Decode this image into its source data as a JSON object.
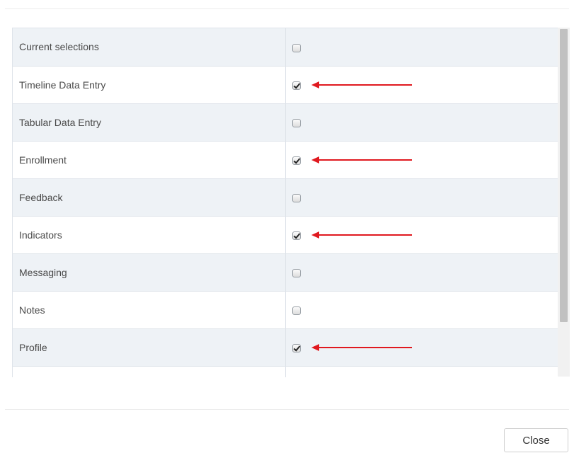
{
  "rows": [
    {
      "label": "Current selections",
      "checked": false,
      "arrow": false
    },
    {
      "label": "Timeline Data Entry",
      "checked": true,
      "arrow": true
    },
    {
      "label": "Tabular Data Entry",
      "checked": false,
      "arrow": false
    },
    {
      "label": "Enrollment",
      "checked": true,
      "arrow": true
    },
    {
      "label": "Feedback",
      "checked": false,
      "arrow": false
    },
    {
      "label": "Indicators",
      "checked": true,
      "arrow": true
    },
    {
      "label": "Messaging",
      "checked": false,
      "arrow": false
    },
    {
      "label": "Notes",
      "checked": false,
      "arrow": false
    },
    {
      "label": "Profile",
      "checked": true,
      "arrow": true
    },
    {
      "label": "",
      "checked": false,
      "arrow": false
    }
  ],
  "footer": {
    "close_label": "Close"
  },
  "colors": {
    "annotation_arrow": "#e0191f",
    "row_stripe": "#eef2f6",
    "border": "#dfe4ea"
  },
  "icons": {
    "annotation": "left-arrow-icon"
  }
}
